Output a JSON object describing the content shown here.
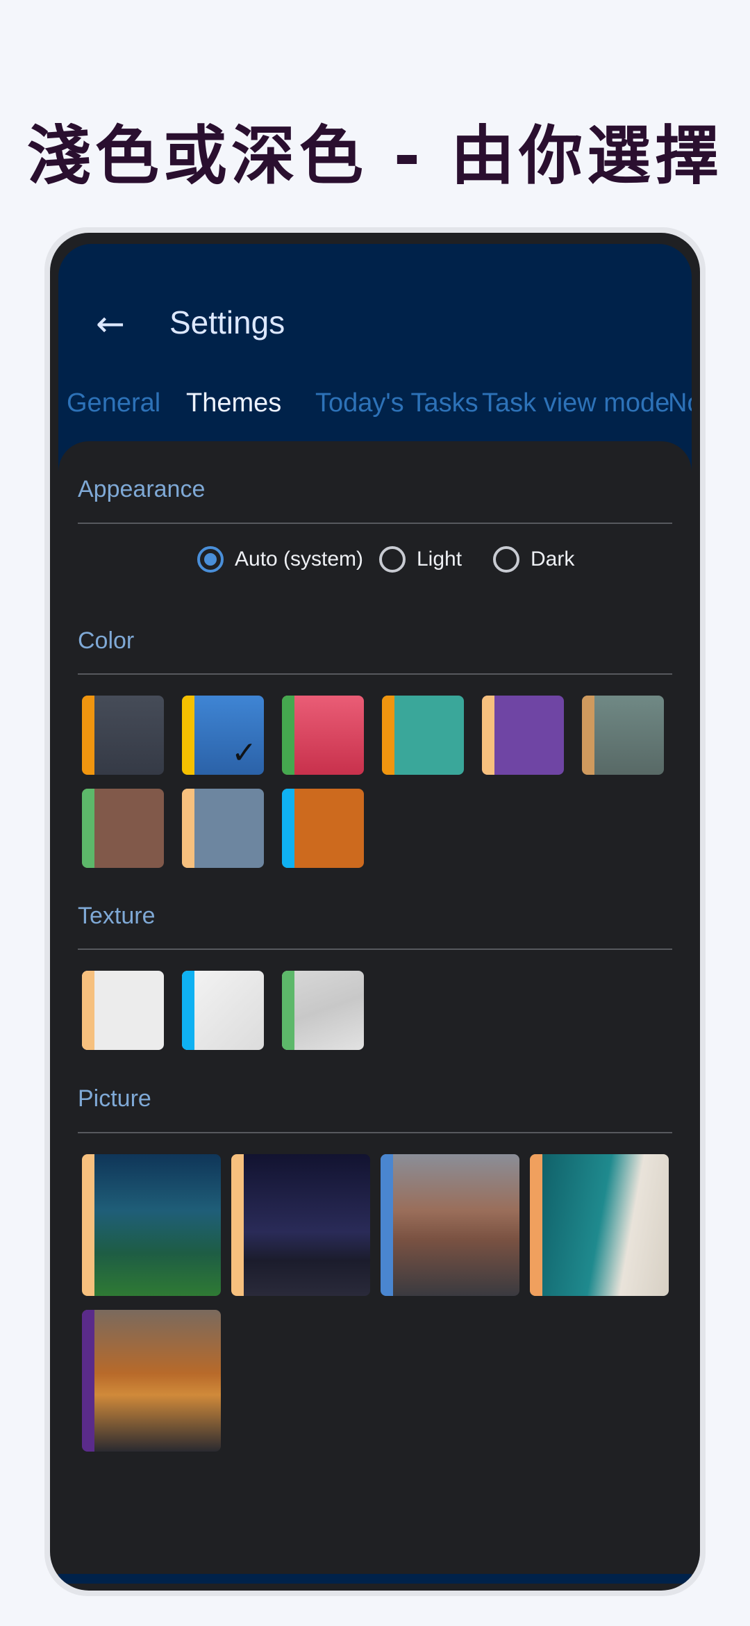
{
  "headline": "淺色或深色 - 由你選擇",
  "header": {
    "title": "Settings",
    "tabs": [
      "General",
      "Themes",
      "Today's Tasks",
      "Task view mode",
      "No"
    ]
  },
  "appearance": {
    "title": "Appearance",
    "options": [
      "Auto (system)",
      "Light",
      "Dark"
    ]
  },
  "color": {
    "title": "Color",
    "swatches": [
      {
        "stripe": "#f0950f",
        "fill": "linear-gradient(#464c58,#353a46)"
      },
      {
        "stripe": "#f5c000",
        "fill": "linear-gradient(#3f85d4,#2b62a8)",
        "selected": true
      },
      {
        "stripe": "#45a84f",
        "fill": "linear-gradient(#ea5d76,#c8314c)"
      },
      {
        "stripe": "#f0950f",
        "fill": "#3aa79a"
      },
      {
        "stripe": "#f6c07e",
        "fill": "#6f45a4"
      },
      {
        "stripe": "#cf9a5e",
        "fill": "linear-gradient(#708985,#586966)"
      },
      {
        "stripe": "#5db86a",
        "fill": "#81594a"
      },
      {
        "stripe": "#f6c07e",
        "fill": "#6d86a0"
      },
      {
        "stripe": "#0fb1f2",
        "fill": "#cd6a1e"
      }
    ]
  },
  "texture": {
    "title": "Texture",
    "swatches": [
      {
        "stripe": "#f6c07e",
        "fill": "#ececec"
      },
      {
        "stripe": "#0fb1f2",
        "fill": "linear-gradient(135deg,#f4f4f4,#dcdcdc)"
      },
      {
        "stripe": "#5db86a",
        "fill": "linear-gradient(160deg,#d8d8d8,#c8c8c8,#e2e2e2)"
      }
    ]
  },
  "picture": {
    "title": "Picture",
    "items": [
      {
        "stripe": "#f6c07e",
        "fill": "linear-gradient(#0f3558 0%,#1f5e78 40%,#1e5d44 70%,#2f7a34 100%)"
      },
      {
        "stripe": "#f6c07e",
        "fill": "linear-gradient(#121330 0%,#2a2b58 55%,#1b1c2c 75%,#2a2a3a 100%)"
      },
      {
        "stripe": "#4a86d0",
        "fill": "linear-gradient(#8a8e98 0%,#9a6e5a 40%,#7a5242 60%,#3a3a40 100%)"
      },
      {
        "stripe": "#f0a05e",
        "fill": "linear-gradient(100deg,#0e5a63 0%,#1f8a8e 50%,#e9e3da 70%,#d7d0c4 100%)"
      },
      {
        "stripe": "#5a2b8a",
        "fill": "linear-gradient(#7a6a5e 0%,#b86a2a 45%,#d08a3a 60%,#2a2a30 100%)"
      }
    ]
  }
}
